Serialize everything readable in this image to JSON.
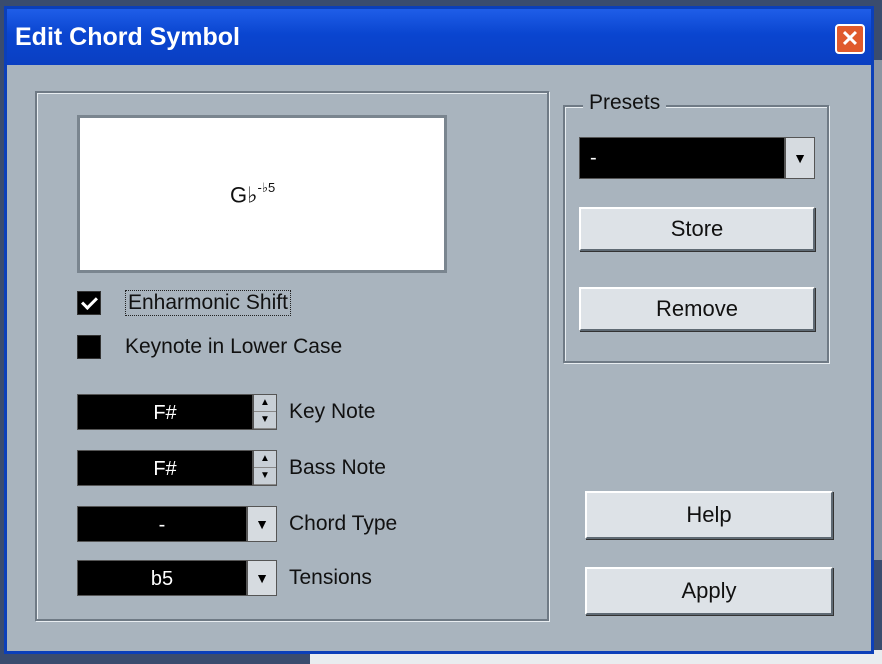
{
  "window": {
    "title": "Edit Chord Symbol",
    "close_symbol": "✕"
  },
  "preview": {
    "chord_main": "G♭",
    "chord_sup": "-♭5"
  },
  "checkboxes": [
    {
      "label": "Enharmonic Shift",
      "checked": true
    },
    {
      "label": "Keynote in Lower Case",
      "checked": false
    }
  ],
  "fields": {
    "key_note": {
      "value": "F#",
      "label": "Key Note"
    },
    "bass_note": {
      "value": "F#",
      "label": "Bass Note"
    },
    "chord_type": {
      "value": "-",
      "label": "Chord Type"
    },
    "tensions": {
      "value": "b5",
      "label": "Tensions"
    }
  },
  "presets": {
    "legend": "Presets",
    "selected": "-",
    "store_label": "Store",
    "remove_label": "Remove"
  },
  "buttons": {
    "help_label": "Help",
    "apply_label": "Apply"
  },
  "icons": {
    "spin_up": "▲",
    "spin_down": "▼",
    "dropdown": "▼"
  },
  "colors": {
    "titlebar": "#0a45d0",
    "dialog_bg": "#a9b4be",
    "field_bg": "#000000"
  }
}
